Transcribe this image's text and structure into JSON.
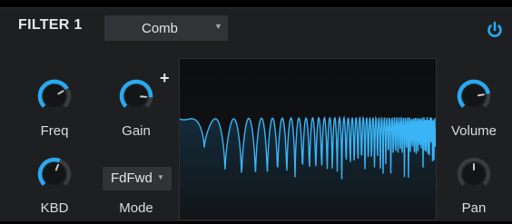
{
  "filter": {
    "title": "FILTER 1",
    "type": "Comb",
    "accent": "#29a9f0",
    "power_on": true
  },
  "knobs": {
    "freq": {
      "label": "Freq",
      "level": 0.72
    },
    "gain": {
      "label": "Gain",
      "level": 0.85
    },
    "kbd": {
      "label": "KBD",
      "level": 0.58
    },
    "volume": {
      "label": "Volume",
      "level": 0.8
    },
    "pan": {
      "label": "Pan",
      "level": 0.5
    }
  },
  "gain_modifier": "+",
  "mode": {
    "label": "Mode",
    "value": "FdFwd"
  },
  "icons": [
    "power-icon",
    "chevron-down-icon"
  ]
}
